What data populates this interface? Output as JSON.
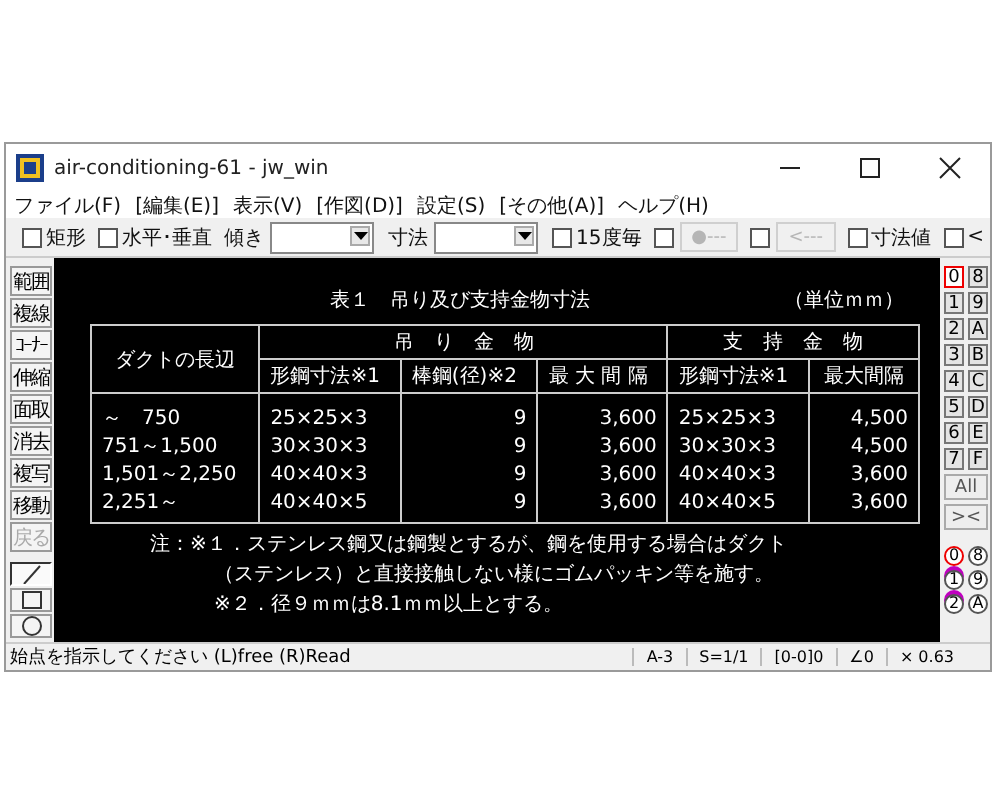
{
  "window": {
    "title": "air-conditioning-61 - jw_win"
  },
  "menu": [
    {
      "label": "ファイル(F)"
    },
    {
      "label": "[編集(E)]"
    },
    {
      "label": "表示(V)"
    },
    {
      "label": "[作図(D)]"
    },
    {
      "label": "設定(S)"
    },
    {
      "label": "[その他(A)]"
    },
    {
      "label": "ヘルプ(H)"
    }
  ],
  "toolbar": [
    {
      "kind": "checkbox",
      "label": "矩形",
      "checked": false
    },
    {
      "kind": "checkbox",
      "label": "水平･垂直",
      "checked": false
    },
    {
      "kind": "select",
      "label": "傾き"
    },
    {
      "kind": "select",
      "label": "寸法"
    },
    {
      "kind": "checkbox",
      "label": "15度毎",
      "checked": false
    },
    {
      "kind": "checkbutton",
      "label": "●---",
      "checked": false,
      "disabled": true
    },
    {
      "kind": "checkbutton",
      "label": "<---",
      "checked": false,
      "disabled": true
    },
    {
      "kind": "checkbox",
      "label": "寸法値",
      "checked": false
    },
    {
      "kind": "checkbox",
      "label": "<",
      "checked": false
    }
  ],
  "tools": [
    {
      "label": "範囲",
      "disabled": false
    },
    {
      "label": "複線",
      "disabled": false
    },
    {
      "label": "ｺｰﾅｰ",
      "disabled": false
    },
    {
      "label": "伸縮",
      "disabled": false
    },
    {
      "label": "面取",
      "disabled": false
    },
    {
      "label": "消去",
      "disabled": false
    },
    {
      "label": "複写",
      "disabled": false
    },
    {
      "label": "移動",
      "disabled": false
    },
    {
      "label": "戻る",
      "disabled": true
    }
  ],
  "shape_tools": [
    {
      "kind": "line",
      "selected": true
    },
    {
      "kind": "rect",
      "selected": false
    },
    {
      "kind": "circle",
      "selected": false
    }
  ],
  "drawing": {
    "title": "表１　吊り及び支持金物寸法",
    "unit": "（単位ｍｍ）",
    "header_top": [
      {
        "label": "ダクトの長辺",
        "rowspan": 2
      },
      {
        "label": "吊　り　金　物",
        "colspan": 3
      },
      {
        "label": "支　持　金　物",
        "colspan": 2
      }
    ],
    "header_sub": [
      "形鋼寸法※1",
      "棒鋼(径)※2",
      "最 大 間 隔",
      "形鋼寸法※1",
      "最大間隔"
    ],
    "rows": [
      [
        "～　750",
        "25×25×3",
        "9",
        "3,600",
        "25×25×3",
        "4,500"
      ],
      [
        "751～1,500",
        "30×30×3",
        "9",
        "3,600",
        "30×30×3",
        "4,500"
      ],
      [
        "1,501～2,250",
        "40×40×3",
        "9",
        "3,600",
        "40×40×3",
        "3,600"
      ],
      [
        "2,251～",
        "40×40×5",
        "9",
        "3,600",
        "40×40×5",
        "3,600"
      ]
    ],
    "notes": [
      "注：※１．ステンレス鋼又は鋼製とするが、鋼を使用する場合はダクト",
      "（ステンレス）と直接接触しない様にゴムパッキン等を施す。",
      "※２．径９ｍｍは8.1ｍｍ以上とする。"
    ]
  },
  "layers": [
    {
      "label": "0",
      "selected": true
    },
    {
      "label": "8",
      "selected": false
    },
    {
      "label": "1",
      "selected": false
    },
    {
      "label": "9",
      "selected": false
    },
    {
      "label": "2",
      "selected": false
    },
    {
      "label": "A",
      "selected": false
    },
    {
      "label": "3",
      "selected": false
    },
    {
      "label": "B",
      "selected": false
    },
    {
      "label": "4",
      "selected": false
    },
    {
      "label": "C",
      "selected": false
    },
    {
      "label": "5",
      "selected": false
    },
    {
      "label": "D",
      "selected": false
    },
    {
      "label": "6",
      "selected": false
    },
    {
      "label": "E",
      "selected": false
    },
    {
      "label": "7",
      "selected": false
    },
    {
      "label": "F",
      "selected": false
    }
  ],
  "layer_buttons": [
    "All",
    "><"
  ],
  "groups": [
    {
      "label": "0",
      "selected": true
    },
    {
      "label": "8",
      "selected": false
    },
    {
      "label": "1",
      "selected": false
    },
    {
      "label": "9",
      "selected": false
    },
    {
      "label": "2",
      "selected": false
    },
    {
      "label": "A",
      "selected": false
    }
  ],
  "status_bar": {
    "message": "始点を指示してください (L)free (R)Read",
    "fields": [
      "A-3",
      "S=1/1",
      "[0-0]0",
      "∠0",
      "× 0.63"
    ]
  }
}
